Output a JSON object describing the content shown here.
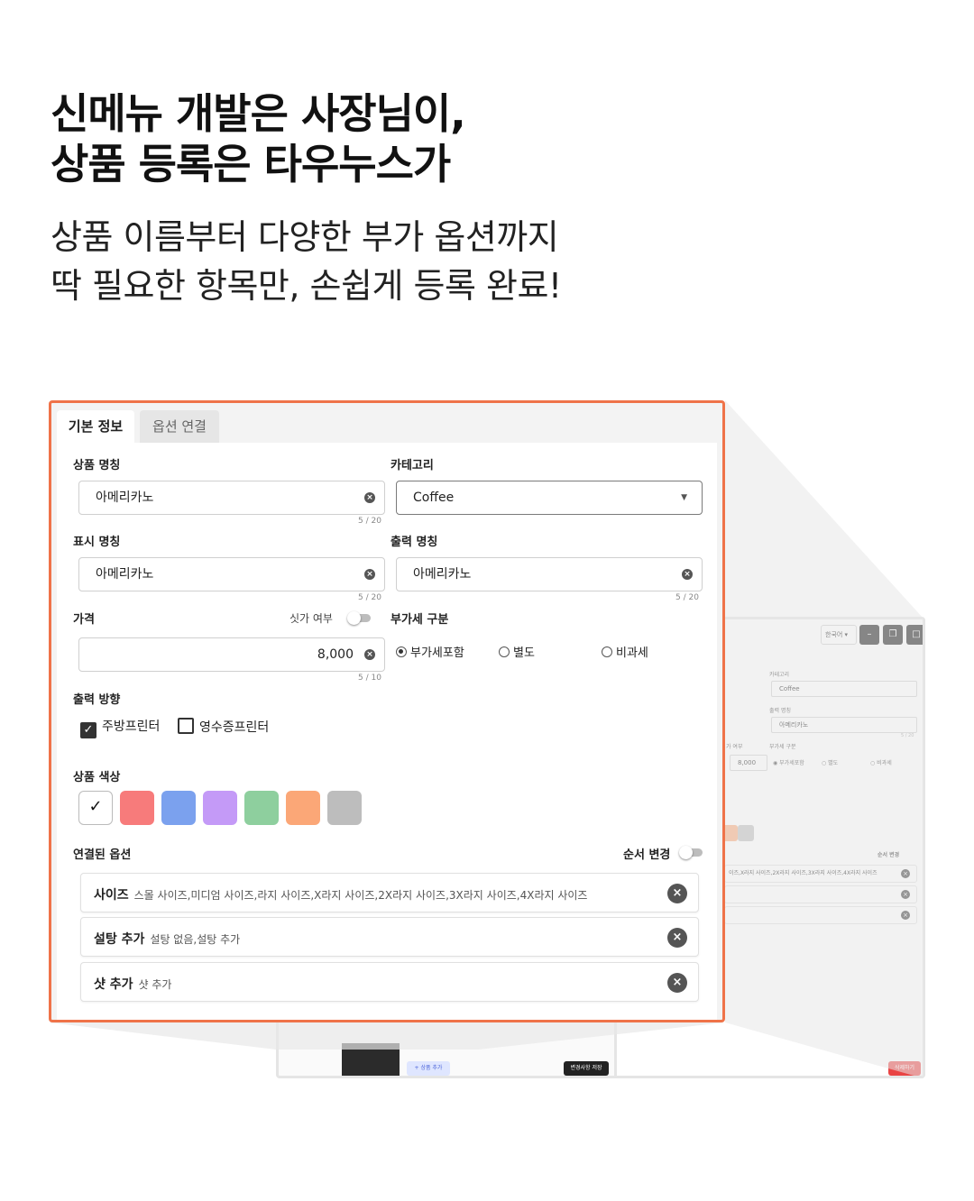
{
  "headline": {
    "line1": "신메뉴 개발은 사장님이,",
    "line2": "상품 등록은 타우누스가"
  },
  "subline": {
    "line1": "상품 이름부터 다양한 부가 옵션까지",
    "line2": "딱 필요한 항목만, 손쉽게 등록 완료!"
  },
  "colors": {
    "highlight_border": "#ef7349",
    "swatches": [
      "#ffffff",
      "#f77b7b",
      "#7ba1ee",
      "#c49af7",
      "#8ecf9e",
      "#fba777",
      "#bdbdbd"
    ]
  },
  "form": {
    "tabs": [
      {
        "label": "기본 정보",
        "active": true
      },
      {
        "label": "옵션 연결",
        "active": false
      }
    ],
    "product_name": {
      "label": "상품 명칭",
      "value": "아메리카노",
      "counter": "5 / 20"
    },
    "category": {
      "label": "카테고리",
      "value": "Coffee"
    },
    "display_name": {
      "label": "표시 명칭",
      "value": "아메리카노",
      "counter": "5 / 20"
    },
    "print_name": {
      "label": "출력 명칭",
      "value": "아메리카노",
      "counter": "5 / 20"
    },
    "price": {
      "label": "가격",
      "value": "8,000",
      "counter": "5 / 10",
      "toggle_label": "싯가 여부",
      "toggle_on": false
    },
    "vat": {
      "label": "부가세 구분",
      "options": [
        "부가세포함",
        "별도",
        "비과세"
      ],
      "selected": "부가세포함"
    },
    "print_direction": {
      "label": "출력 방향",
      "options": [
        {
          "label": "주방프린터",
          "checked": true
        },
        {
          "label": "영수증프린터",
          "checked": false
        }
      ]
    },
    "product_color": {
      "label": "상품 색상",
      "selected_index": 0
    },
    "linked_options": {
      "label": "연결된 옵션",
      "reorder_label": "순서 변경",
      "reorder_on": false,
      "items": [
        {
          "name": "사이즈",
          "values": "스몰 사이즈,미디엄 사이즈,라지 사이즈,X라지 사이즈,2X라지 사이즈,3X라지 사이즈,4X라지 사이즈"
        },
        {
          "name": "설탕 추가",
          "values": "설탕 없음,설탕 추가"
        },
        {
          "name": "샷 추가",
          "values": "샷 추가"
        }
      ]
    }
  },
  "background_app": {
    "language": "한국어",
    "category_label": "카테고리",
    "category_value": "Coffee",
    "print_name_label": "출력 명칭",
    "print_name_value": "아메리카노",
    "counter": "5 / 20",
    "toggle_label": "가 여부",
    "vat_label": "부가세 구분",
    "vat_options": [
      "부가세포함",
      "별도",
      "비과세"
    ],
    "price_value": "8,000",
    "price_counter": "5 / 10",
    "reorder_label": "순서 변경",
    "size_values": "이즈,X라지 사이즈,2X라지 사이즈,3X라지 사이즈,4X라지 사이즈",
    "add_product": "+ 상품 추가",
    "save_changes": "변경사항 저장",
    "delete": "삭제하기"
  }
}
